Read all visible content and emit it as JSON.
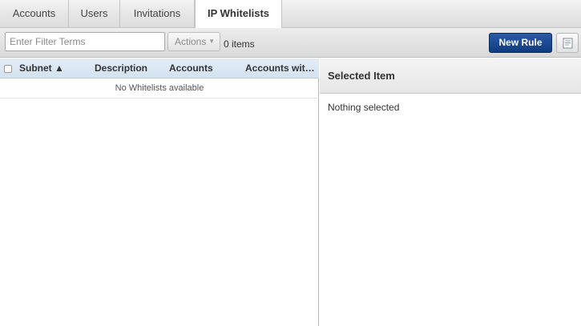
{
  "tabs": [
    {
      "label": "Accounts",
      "active": false
    },
    {
      "label": "Users",
      "active": false
    },
    {
      "label": "Invitations",
      "active": false
    },
    {
      "label": "IP Whitelists",
      "active": true
    }
  ],
  "toolbar": {
    "filter_placeholder": "Enter Filter Terms",
    "filter_value": "",
    "actions_label": "Actions",
    "items_count": "0 items",
    "new_rule_label": "New Rule",
    "report_icon": "report-icon"
  },
  "list": {
    "columns": [
      "Subnet ▲",
      "Description",
      "Accounts",
      "Accounts wit…"
    ],
    "sort_column": "Subnet",
    "sort_direction": "ascending",
    "empty_message": "No Whitelists available"
  },
  "detail": {
    "title": "Selected Item",
    "body": "Nothing selected"
  },
  "colors": {
    "primary_button": "#0f3b7e",
    "list_header": "#d3e2f1",
    "active_tab": "#ffffff"
  }
}
